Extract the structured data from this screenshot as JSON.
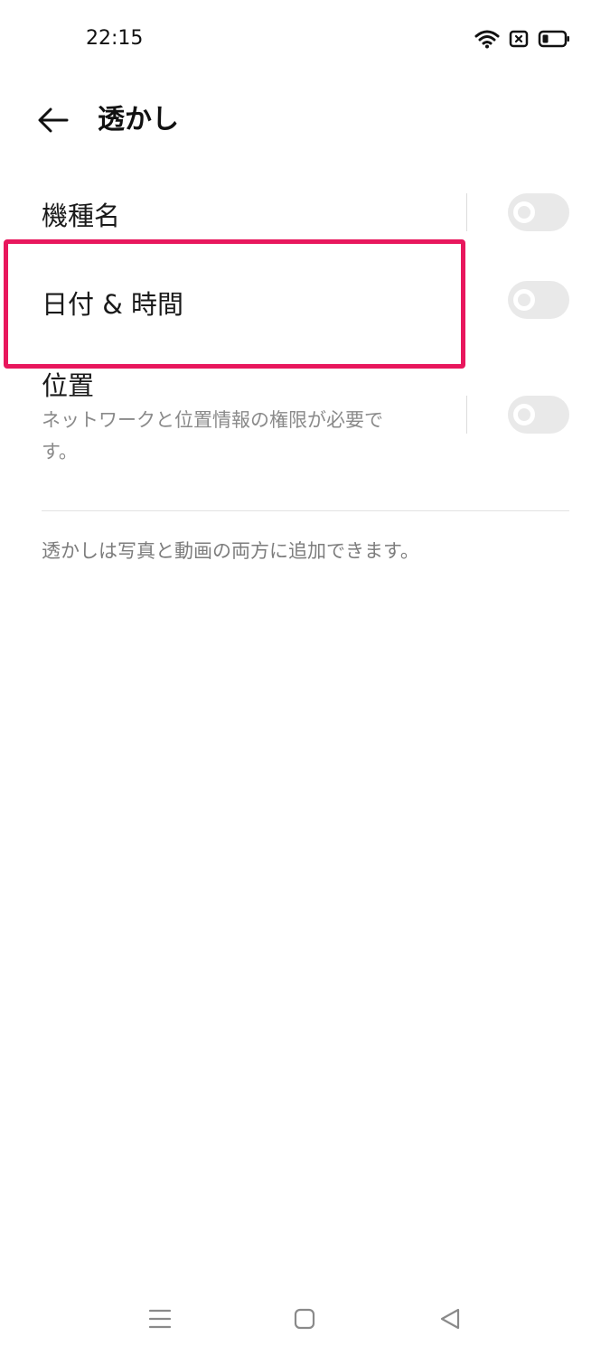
{
  "status_bar": {
    "time": "22:15",
    "icons": [
      "wifi-icon",
      "sim-error-icon",
      "battery-icon"
    ]
  },
  "header": {
    "back_icon": "arrow-left-icon",
    "title": "透かし"
  },
  "settings": {
    "device_name": {
      "label": "機種名",
      "enabled": false
    },
    "date_time": {
      "label": "日付 & 時間",
      "enabled": false
    },
    "location": {
      "label": "位置",
      "description_line1": "ネットワークと位置情報の権限が必要で",
      "description_line2": "す。",
      "enabled": false
    }
  },
  "footnote": "透かしは写真と動画の両方に追加できます。",
  "highlight": {
    "color": "#e8175d",
    "target": "date_time"
  },
  "nav_bar": {
    "icons": [
      "menu-icon",
      "home-icon",
      "back-triangle-icon"
    ]
  }
}
